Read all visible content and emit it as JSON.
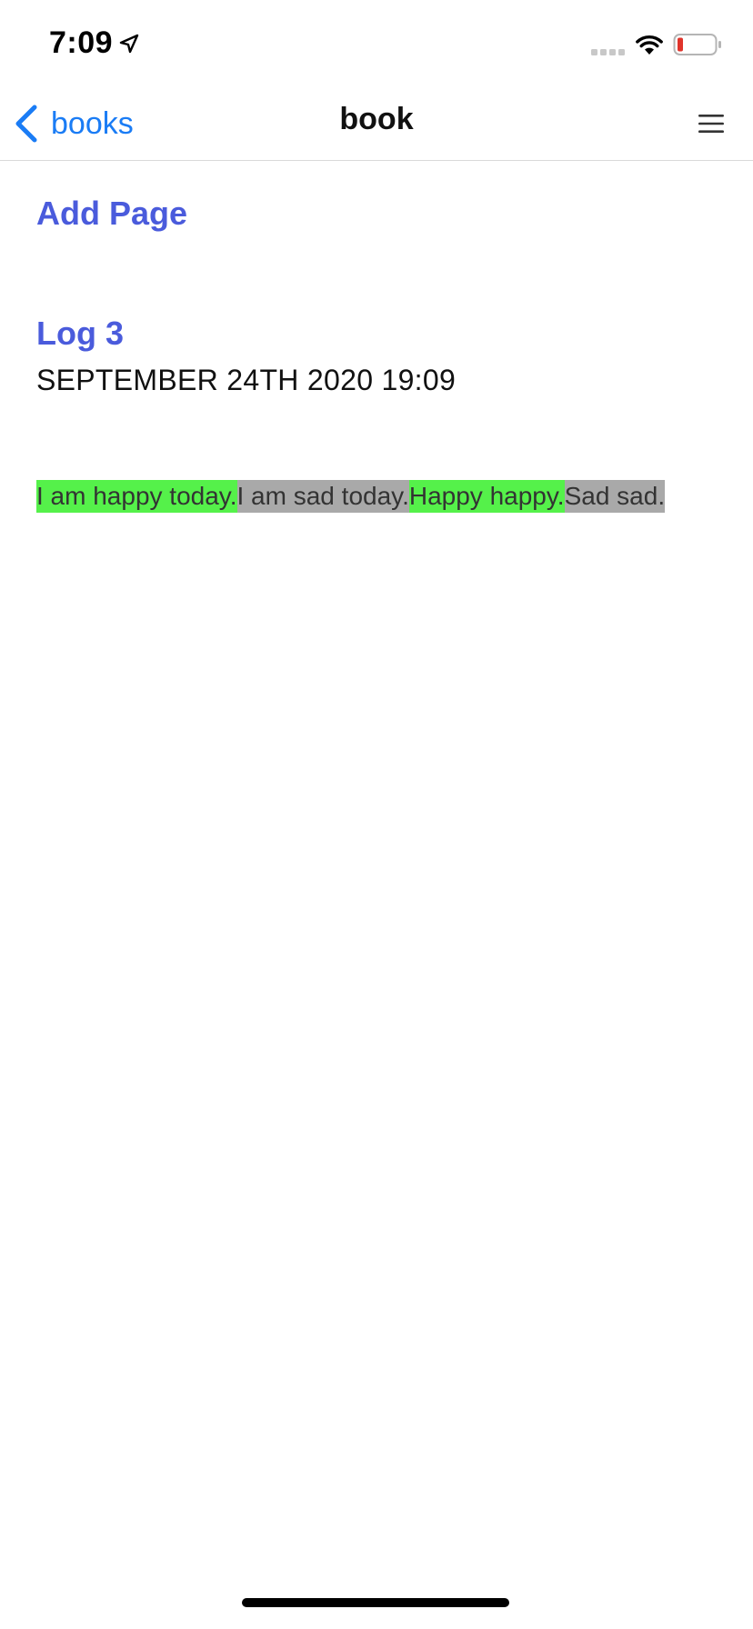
{
  "status_bar": {
    "time": "7:09",
    "icons": [
      "location-arrow-icon",
      "cellular-signal-icon",
      "wifi-icon",
      "battery-low-icon"
    ],
    "battery_color": "#e0342b"
  },
  "nav": {
    "back_label": "books",
    "title": "book",
    "back_icon": "chevron-left-icon",
    "menu_icon": "hamburger-menu-icon",
    "accent_color": "#1a7cf5"
  },
  "content": {
    "add_page_label": "Add Page",
    "link_color": "#4a5bdc",
    "log": {
      "title": "Log 3",
      "date": "SEPTEMBER 24TH 2020 19:09",
      "segments": [
        {
          "text": "I am happy today.",
          "sentiment": "happy",
          "highlight_color": "#55f14a"
        },
        {
          "text": "I am sad today.",
          "sentiment": "sad",
          "highlight_color": "#a9a9a9"
        },
        {
          "text": "Happy happy.",
          "sentiment": "happy",
          "highlight_color": "#55f14a"
        },
        {
          "text": "Sad sad.",
          "sentiment": "sad",
          "highlight_color": "#a9a9a9"
        }
      ]
    }
  }
}
